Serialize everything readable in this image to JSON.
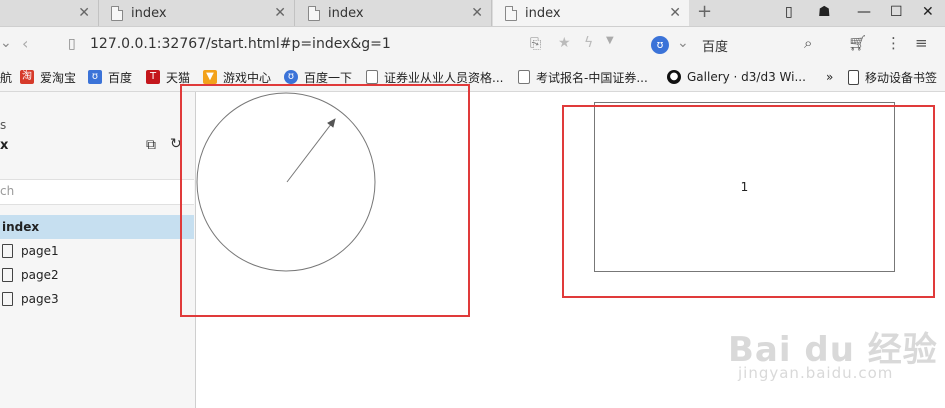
{
  "tabs": [
    {
      "label": "index"
    },
    {
      "label": "index"
    },
    {
      "label": "index",
      "active": true
    }
  ],
  "address": {
    "url": "127.0.0.1:32767/start.html#p=index&g=1",
    "search_engine": "百度"
  },
  "bookmarks": [
    {
      "label": "航"
    },
    {
      "label": "爱淘宝"
    },
    {
      "label": "百度"
    },
    {
      "label": "天猫"
    },
    {
      "label": "游戏中心"
    },
    {
      "label": "百度一下"
    },
    {
      "label": "证券业从业人员资格..."
    },
    {
      "label": "考试报名-中国证券..."
    },
    {
      "label": "Gallery · d3/d3 Wi..."
    },
    {
      "label": "»"
    },
    {
      "label": "移动设备书签"
    }
  ],
  "sidebar": {
    "header_small": "s",
    "header_title": "x",
    "search_placeholder": "ch",
    "items": [
      {
        "label": "index",
        "selected": true
      },
      {
        "label": "page1"
      },
      {
        "label": "page2"
      },
      {
        "label": "page3"
      }
    ]
  },
  "canvas": {
    "rect_label": "1"
  },
  "watermark": {
    "logo": "Bai du 经验",
    "site": "jingyan.baidu.com"
  },
  "colors": {
    "highlight_red": "#e03a3a",
    "selected_nav": "#c6dff0",
    "baidu_blue": "#3b73d8"
  },
  "icons": {
    "tab": "document-icon",
    "close": "close-icon",
    "back": "back-arrow-icon",
    "menu": "kebab-menu-icon"
  }
}
